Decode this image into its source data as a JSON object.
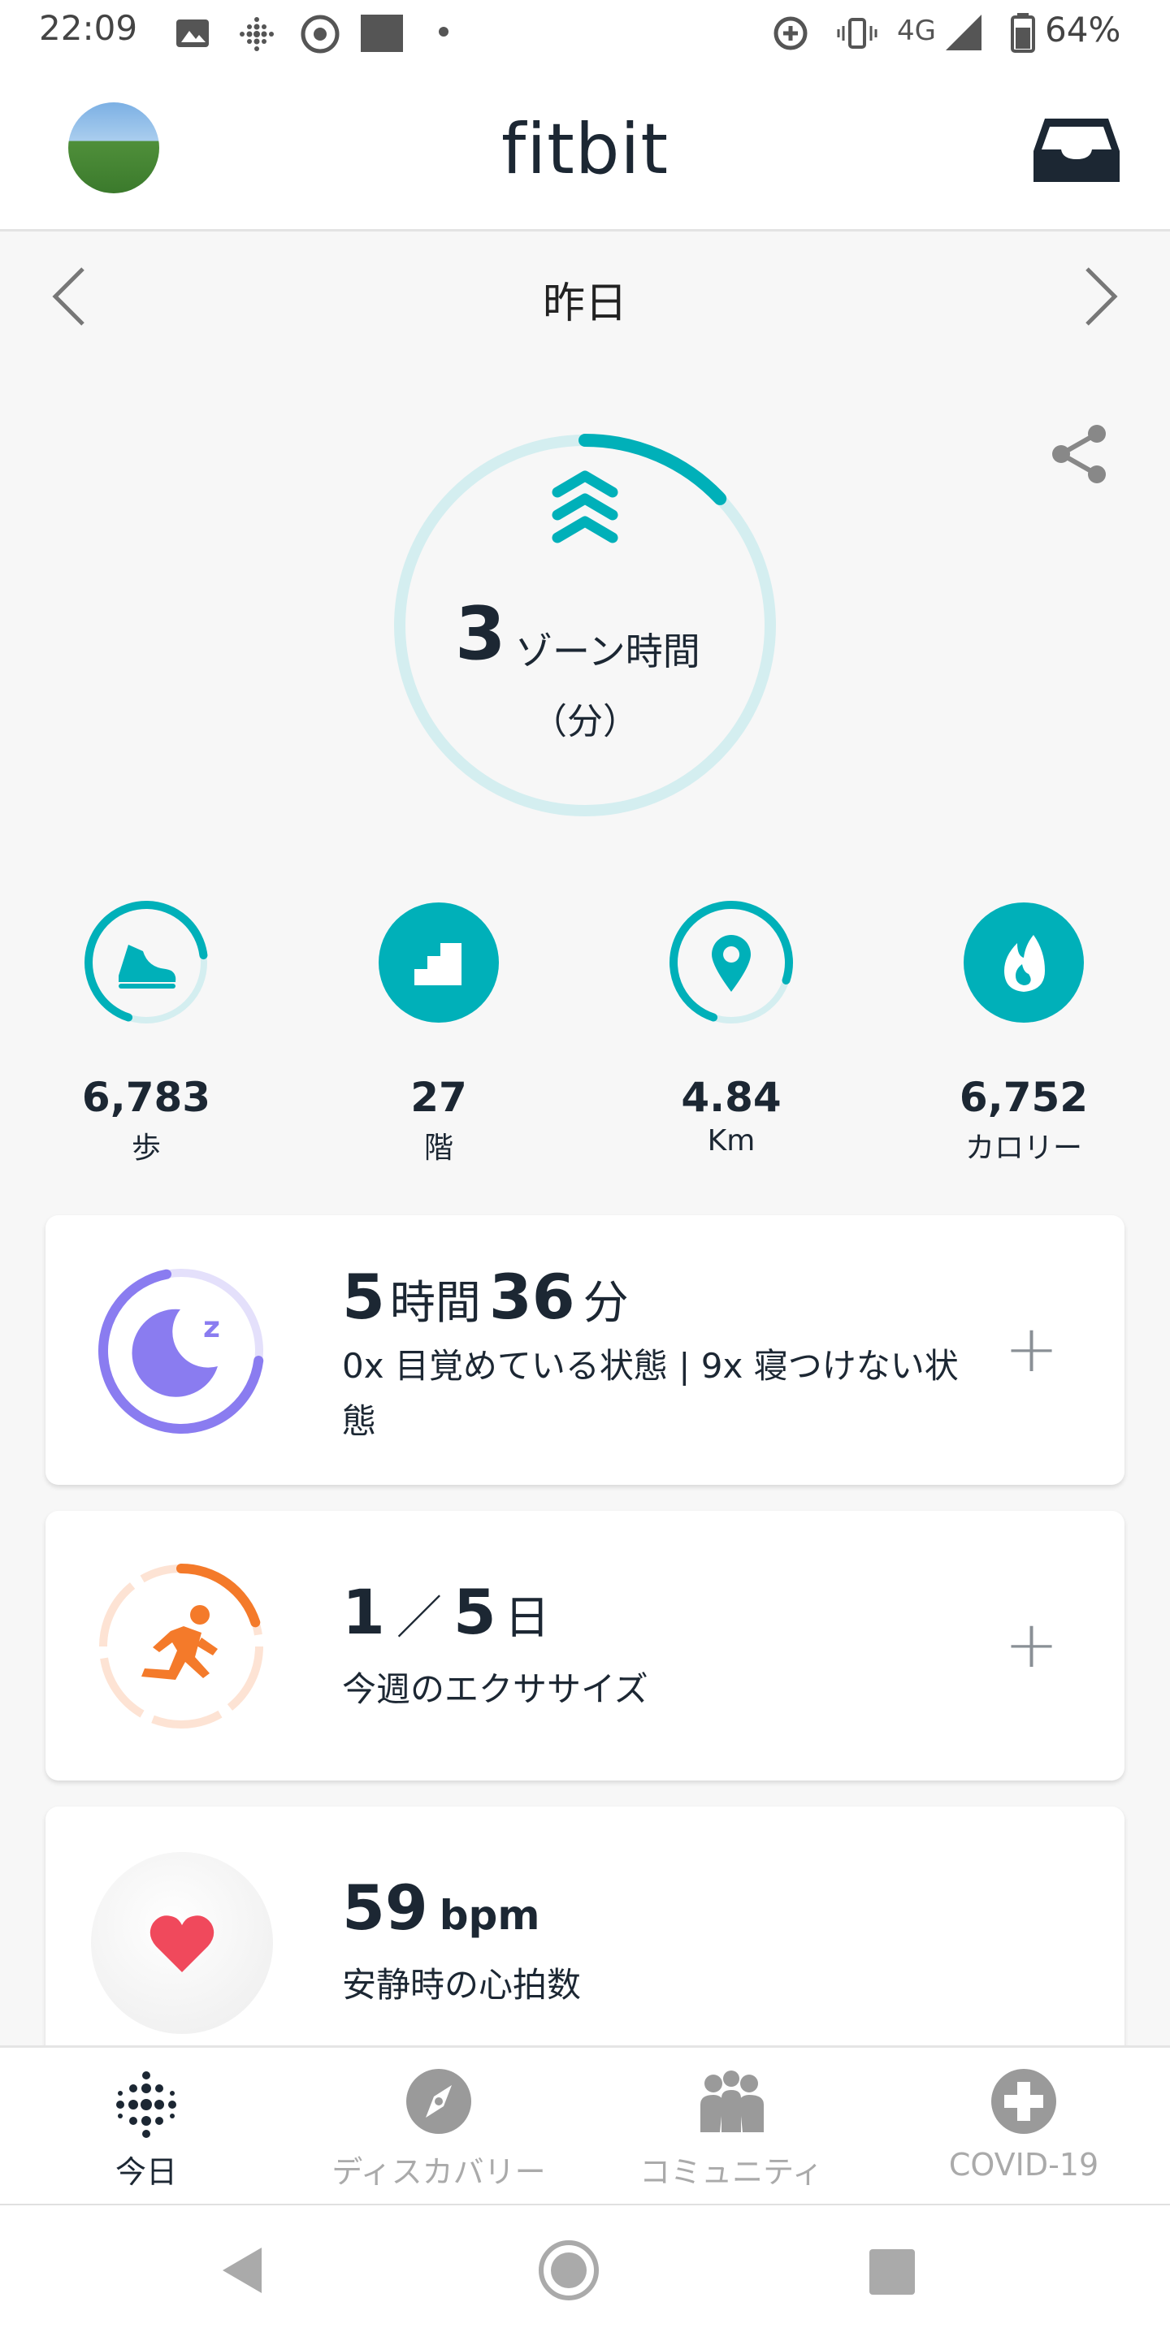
{
  "status_bar": {
    "time": "22:09",
    "network": "4G",
    "battery": "64%"
  },
  "header": {
    "brand": "fitbit"
  },
  "date_nav": {
    "label": "昨日"
  },
  "zone": {
    "value": "3",
    "unit": "ゾーン時間",
    "unit2": "（分）",
    "progress": 0.13
  },
  "stats": [
    {
      "icon": "shoe-icon",
      "value": "6,783",
      "label": "歩",
      "progress": 0.68
    },
    {
      "icon": "stairs-icon",
      "value": "27",
      "label": "階",
      "progress": 1.0
    },
    {
      "icon": "location-pin-icon",
      "value": "4.84",
      "label": "Km",
      "progress": 0.75
    },
    {
      "icon": "flame-icon",
      "value": "6,752",
      "label": "カロリー",
      "progress": 1.0
    }
  ],
  "sleep": {
    "hours": "5",
    "hours_unit": "時間",
    "minutes": "36",
    "minutes_unit": "分",
    "detail": "0x 目覚めている状態 | 9x 寝つけない状態",
    "progress": 0.7
  },
  "exercise": {
    "done": "1",
    "sep": "／",
    "goal": "5",
    "unit": "日",
    "detail": "今週のエクササイズ",
    "progress": 0.2
  },
  "heart": {
    "value": "59",
    "unit": "bpm",
    "detail": "安静時の心拍数"
  },
  "nav": {
    "today": "今日",
    "discover": "ディスカバリー",
    "community": "コミュニティ",
    "covid": "COVID-19"
  },
  "colors": {
    "teal": "#00b0b9",
    "teal_light": "#d4eef0",
    "purple": "#8a7cf0",
    "orange": "#f47a2a",
    "heart": "#f0495c"
  }
}
